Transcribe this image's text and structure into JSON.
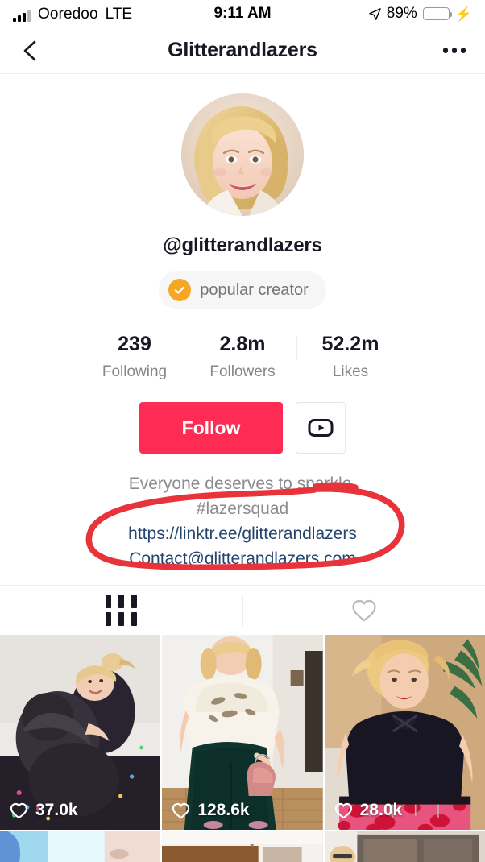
{
  "status_bar": {
    "carrier": "Ooredoo",
    "network": "LTE",
    "time": "9:11 AM",
    "battery_percent": "89%",
    "location_icon": "location-arrow-icon",
    "charging_icon": "lightning-bolt-icon",
    "battery_fill_color": "#3ddc56"
  },
  "nav": {
    "back_icon": "chevron-left-icon",
    "title": "Glitterandlazers",
    "more_icon": "more-horizontal-icon"
  },
  "profile": {
    "avatar_alt": "blonde-woman-smiling-avatar",
    "handle": "@glitterandlazers",
    "badge_label": "popular creator",
    "badge_icon": "verified-check-icon",
    "badge_color": "#f5a623"
  },
  "stats": [
    {
      "value": "239",
      "label": "Following"
    },
    {
      "value": "2.8m",
      "label": "Followers"
    },
    {
      "value": "52.2m",
      "label": "Likes"
    }
  ],
  "actions": {
    "follow_label": "Follow",
    "follow_color": "#fe2c55",
    "youtube_icon": "youtube-play-icon"
  },
  "bio": {
    "lines": [
      "Everyone deserves to sparkle.",
      "#lazersquad"
    ],
    "links": [
      "https://linktr.ee/glitterandlazers",
      "Contact@glitterandlazers.com"
    ],
    "link_color": "#25456e"
  },
  "annotation": {
    "shape": "hand-drawn-red-ellipse",
    "color": "#e8333a",
    "encircles": "bio links"
  },
  "tabs": [
    {
      "icon": "grid-bars-icon",
      "label": "Videos",
      "active": true
    },
    {
      "icon": "heart-outline-icon",
      "label": "Liked",
      "active": false
    }
  ],
  "videos": [
    {
      "likes": "37.0k",
      "alt": "woman-hugging-dark-dog"
    },
    {
      "likes": "128.6k",
      "alt": "woman-crop-top-green-pants-pink-bag"
    },
    {
      "likes": "28.0k",
      "alt": "woman-black-top-pink-leopard-skirt"
    }
  ],
  "videos_row2": [
    {
      "alt": "blue-cyan-scene"
    },
    {
      "alt": "white-brown-cabinets-scene"
    },
    {
      "alt": "person-with-glasses-scene"
    }
  ]
}
